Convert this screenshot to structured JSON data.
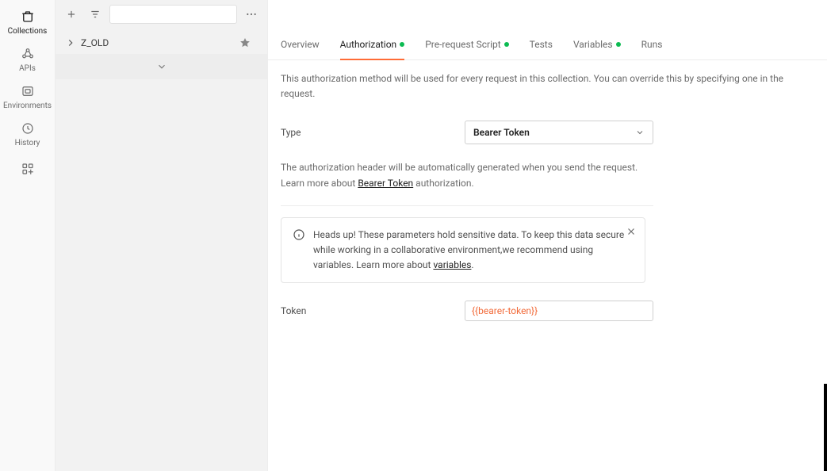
{
  "nav": {
    "items": [
      {
        "label": "Collections",
        "icon": "box-icon",
        "active": true
      },
      {
        "label": "APIs",
        "icon": "apis-icon"
      },
      {
        "label": "Environments",
        "icon": "env-icon"
      },
      {
        "label": "History",
        "icon": "history-icon"
      },
      {
        "label": "",
        "icon": "grid-add-icon"
      }
    ]
  },
  "sidebar": {
    "collection_name": "Z_OLD"
  },
  "tabs": {
    "overview": "Overview",
    "authorization": "Authorization",
    "prerequest": "Pre-request Script",
    "tests": "Tests",
    "variables": "Variables",
    "runs": "Runs"
  },
  "auth": {
    "intro": "This authorization method will be used for every request in this collection. You can override this by specifying one in the request.",
    "type_label": "Type",
    "type_value": "Bearer Token",
    "help_pre": "The authorization header will be automatically generated when you send the request. Learn more about ",
    "help_link": "Bearer Token",
    "help_post": " authorization.",
    "notice": "Heads up! These parameters hold sensitive data. To keep this data secure while working in a collaborative environment,we recommend using variables. Learn more about ",
    "notice_link": "variables",
    "token_label": "Token",
    "token_value": "{{bearer-token}}"
  }
}
